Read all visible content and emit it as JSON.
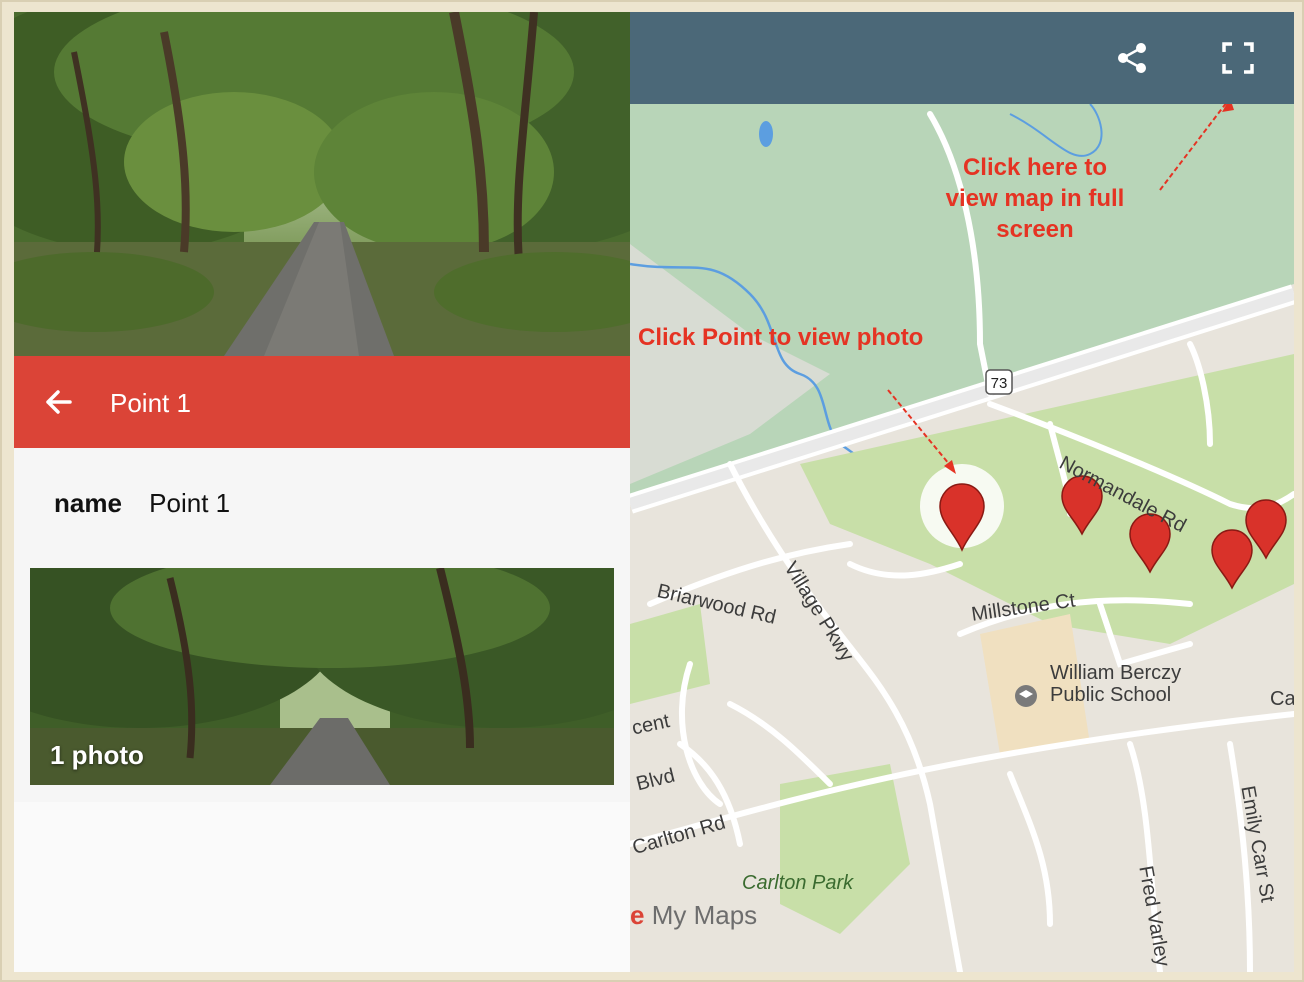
{
  "feature_panel": {
    "header_title": "Point 1",
    "field": {
      "key": "name",
      "value": "Point 1"
    },
    "photo_count_label": "1 photo"
  },
  "map": {
    "route_shield": "73",
    "street_labels": {
      "normandale": "Normandale Rd",
      "briarwood": "Briarwood Rd",
      "village": "Village Pkwy",
      "millstone": "Millstone Ct",
      "school_line1": "William Berczy",
      "school_line2": "Public School",
      "crescent": "cent",
      "blvd": "Blvd",
      "carlton_rd": "Carlton Rd",
      "carlton_park": "Carlton Park",
      "fred_varley": "Fred Varley",
      "emily_carr": "Emily Carr St",
      "edge_ca": "Ca"
    },
    "brand": {
      "e": "e",
      "text": "My Maps"
    },
    "marker_count": 5
  },
  "annotations": {
    "fullscreen_line1": "Click here to",
    "fullscreen_line2": "view map in full",
    "fullscreen_line3": "screen",
    "point_hint": "Click Point to view photo"
  },
  "icons": {
    "back": "arrow-back-icon",
    "share": "share-icon",
    "fullscreen": "fullscreen-icon",
    "school": "school-icon",
    "marker": "map-marker-icon"
  },
  "colors": {
    "header_red": "#db4437",
    "toolbar_slate": "#4b6878",
    "annotation_red": "#e53323",
    "park_green": "#c8dfa8",
    "water_blue": "#5c9ee0",
    "marker_red": "#d9322a"
  }
}
